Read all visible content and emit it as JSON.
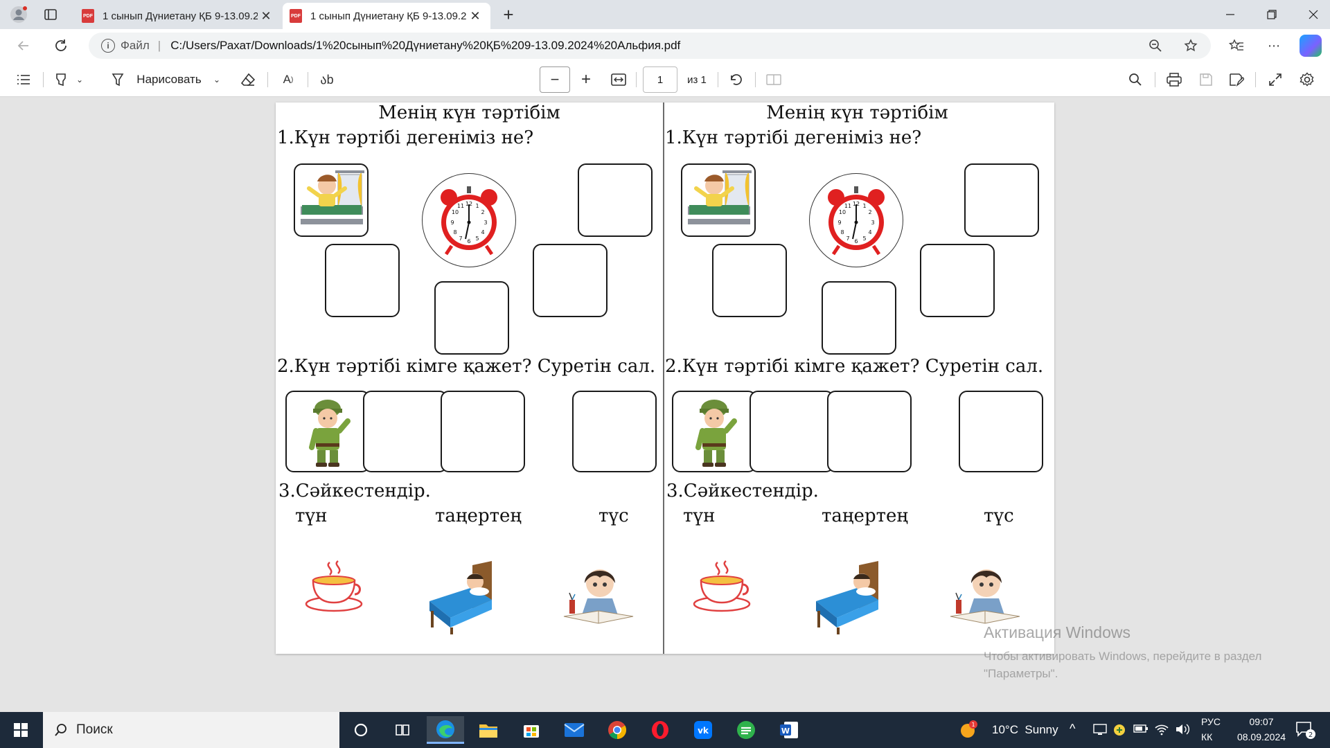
{
  "browser": {
    "tabs": [
      {
        "title": "1 сынып Дүниетану ҚБ 9-13.09.2024 Альфия.pdf",
        "active": false
      },
      {
        "title": "1 сынып Дүниетану ҚБ 9-13.09.2024 Альфия.pdf",
        "active": true
      }
    ],
    "address": {
      "scheme_label": "Файл",
      "url": "C:/Users/Рахат/Downloads/1%20сынып%20Дүниетану%20ҚБ%209-13.09.2024%20Альфия.pdf"
    }
  },
  "pdf_toolbar": {
    "draw_label": "Нарисовать",
    "page_number": "1",
    "page_total": "из 1"
  },
  "document": {
    "title": "Менің күн тәртібім",
    "q1": "1.Күн тәртібі дегеніміз не?",
    "q2": "2.Күн тәртібі кімге қажет? Суретін сал.",
    "q3": "3.Сәйкестендір.",
    "words": [
      "түн",
      "таңертең",
      "түс"
    ]
  },
  "watermark": {
    "title": "Активация Windows",
    "line1": "Чтобы активировать Windows, перейдите в раздел",
    "line2": "\"Параметры\"."
  },
  "taskbar": {
    "search_placeholder": "Поиск",
    "weather": "10°C  Sunny",
    "weather_badge": "1",
    "lang1": "РУС",
    "lang2": "КК",
    "time": "09:07",
    "date": "08.09.2024",
    "notifications": "2"
  }
}
